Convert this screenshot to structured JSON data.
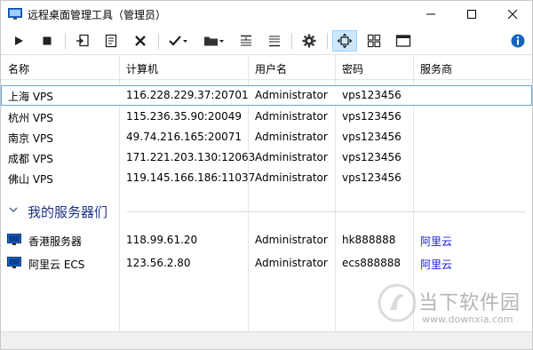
{
  "window": {
    "title": "远程桌面管理工具（管理员）",
    "minimize_symbol": "—",
    "close_symbol": "✕"
  },
  "toolbar": {
    "icons": [
      "play-icon",
      "stop-icon",
      "import-icon",
      "notes-icon",
      "delete-icon",
      "check-icon",
      "folder-icon",
      "align-top-icon",
      "align-bottom-icon",
      "settings-icon",
      "fit-screen-icon",
      "grid-icon",
      "window-icon",
      "info-icon"
    ]
  },
  "table": {
    "columns": [
      "名称",
      "计算机",
      "用户名",
      "密码",
      "服务商"
    ],
    "rows": [
      {
        "name": "上海 VPS",
        "computer": "116.228.229.37:20701",
        "user": "Administrator",
        "password": "vps123456",
        "provider": ""
      },
      {
        "name": "杭州 VPS",
        "computer": "115.236.35.90:20049",
        "user": "Administrator",
        "password": "vps123456",
        "provider": ""
      },
      {
        "name": "南京 VPS",
        "computer": "49.74.216.165:20071",
        "user": "Administrator",
        "password": "vps123456",
        "provider": ""
      },
      {
        "name": "成都 VPS",
        "computer": "171.221.203.130:12063",
        "user": "Administrator",
        "password": "vps123456",
        "provider": ""
      },
      {
        "name": "佛山 VPS",
        "computer": "119.145.166.186:11037",
        "user": "Administrator",
        "password": "vps123456",
        "provider": ""
      }
    ],
    "group": {
      "label": "我的服务器们",
      "rows": [
        {
          "name": "香港服务器",
          "computer": "118.99.61.20",
          "user": "Administrator",
          "password": "hk888888",
          "provider": "阿里云"
        },
        {
          "name": "阿里云 ECS",
          "computer": "123.56.2.80",
          "user": "Administrator",
          "password": "ecs888888",
          "provider": "阿里云"
        }
      ]
    }
  },
  "watermark": {
    "cn": "当下软件园",
    "url": "www.downxia.com"
  },
  "colors": {
    "accent": "#1e3287",
    "link": "#1a1ae6",
    "selection_border": "#6ba7e0",
    "toolbar_active": "#cce8ff"
  }
}
